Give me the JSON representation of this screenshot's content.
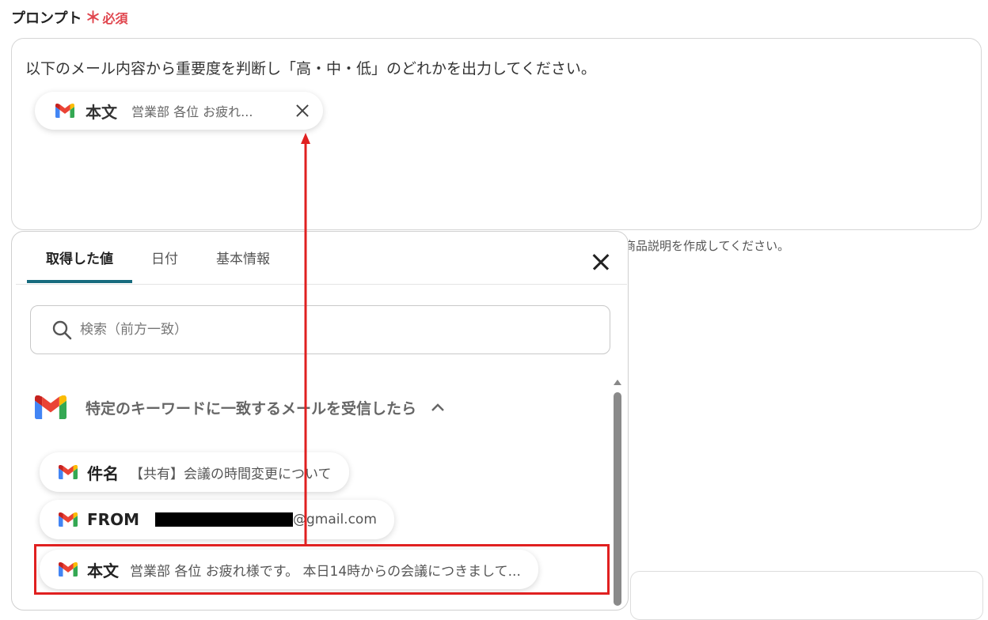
{
  "field": {
    "label": "プロンプト",
    "required_mark": "＊",
    "required_text": "必須"
  },
  "prompt": {
    "text": "以下のメール内容から重要度を判断し「高・中・低」のどれかを出力してください。",
    "chip": {
      "icon": "gmail-icon",
      "key": "本文",
      "value": "営業部 各位 お疲れ..."
    }
  },
  "background_hint": "商品説明を作成してください。",
  "panel": {
    "tabs": [
      {
        "label": "取得した値",
        "active": true
      },
      {
        "label": "日付",
        "active": false
      },
      {
        "label": "基本情報",
        "active": false
      }
    ],
    "search_placeholder": "検索（前方一致）",
    "group": {
      "icon": "gmail-icon",
      "title": "特定のキーワードに一致するメールを受信したら",
      "expanded": true
    },
    "items": [
      {
        "key": "件名",
        "value": "【共有】会議の時間変更について"
      },
      {
        "key": "FROM",
        "value": "@gmail.com",
        "redacted": true
      },
      {
        "key": "本文",
        "value": "営業部 各位 お疲れ様です。 本日14時からの会議につきまして..."
      }
    ]
  },
  "colors": {
    "accent_tab": "#176b7e",
    "required": "#e0464e",
    "highlight": "#e02020",
    "gmail_red": "#ea4335",
    "gmail_blue": "#4285f4",
    "gmail_green": "#34a853",
    "gmail_yellow": "#fbbc04"
  }
}
